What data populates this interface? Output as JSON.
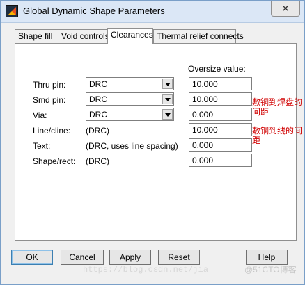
{
  "window": {
    "title": "Global Dynamic Shape Parameters",
    "close_glyph": "✕"
  },
  "tabs": [
    {
      "label": "Shape fill"
    },
    {
      "label": "Void controls"
    },
    {
      "label": "Clearances"
    },
    {
      "label": "Thermal relief connects"
    }
  ],
  "clearances": {
    "oversize_header": "Oversize value:",
    "rows": [
      {
        "label": "Thru pin:",
        "method": "DRC",
        "oversize": "10.000"
      },
      {
        "label": "Smd pin:",
        "method": "DRC",
        "oversize": "10.000"
      },
      {
        "label": "Via:",
        "method": "DRC",
        "oversize": "0.000"
      },
      {
        "label": "Line/cline:",
        "method": "(DRC)",
        "oversize": "10.000"
      },
      {
        "label": "Text:",
        "method": "(DRC, uses line spacing)",
        "oversize": "0.000"
      },
      {
        "label": "Shape/rect:",
        "method": "(DRC)",
        "oversize": "0.000"
      }
    ]
  },
  "annotations": {
    "pad_note_line1": "敷铜到焊盘的",
    "pad_note_line2": "间距",
    "line_note_line1": "敷铜到线的间",
    "line_note_line2": "距",
    "color": "#d00000"
  },
  "buttons": {
    "ok": "OK",
    "cancel": "Cancel",
    "apply": "Apply",
    "reset": "Reset",
    "help": "Help"
  },
  "watermark": {
    "url": "https://blog.csdn.net/jia",
    "badge": "@51CTO博客"
  },
  "colors": {
    "titlebar": "#dbe7f6",
    "panel": "#ffffff",
    "dialog": "#f0f0f0"
  }
}
